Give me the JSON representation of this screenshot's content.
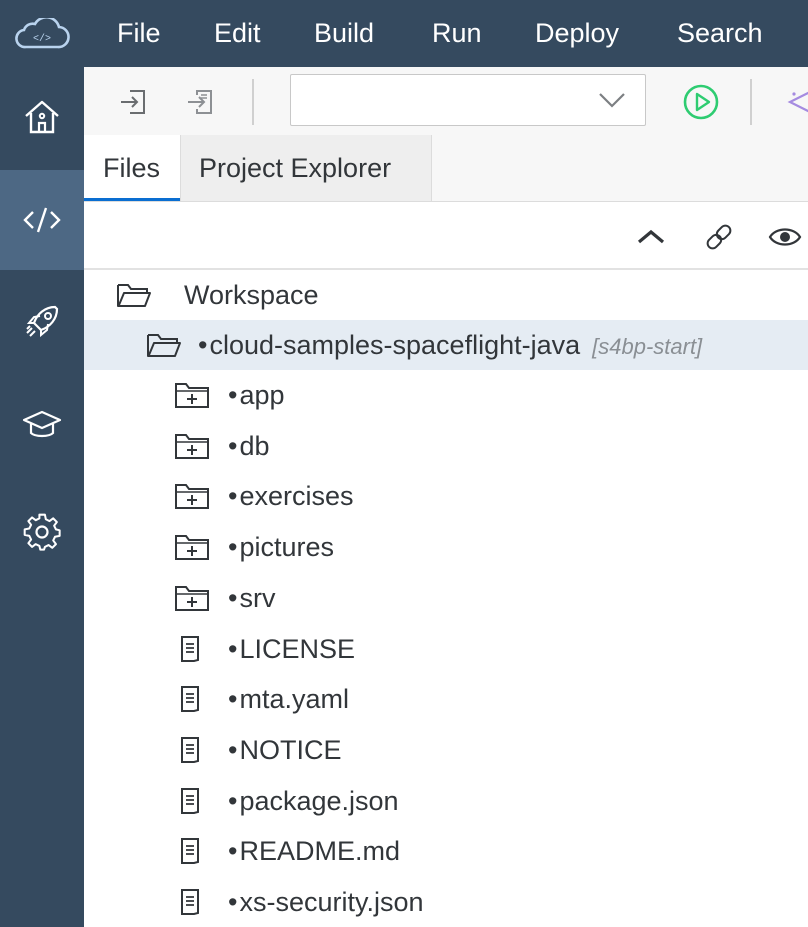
{
  "menu": {
    "items": [
      "File",
      "Edit",
      "Build",
      "Run",
      "Deploy",
      "Search"
    ]
  },
  "sidebar": {
    "items": [
      {
        "name": "home",
        "icon": "home-icon"
      },
      {
        "name": "development",
        "icon": "code-icon",
        "active": true
      },
      {
        "name": "deploy",
        "icon": "rocket-icon"
      },
      {
        "name": "learning",
        "icon": "graduation-cap-icon"
      },
      {
        "name": "preferences",
        "icon": "gear-icon"
      }
    ]
  },
  "toolbar": {
    "run_configuration_value": "",
    "icons": [
      "import-icon",
      "export-icon",
      "run-icon",
      "assistant-icon"
    ]
  },
  "tabs": [
    {
      "label": "Files",
      "active": true
    },
    {
      "label": "Project Explorer",
      "active": false
    }
  ],
  "tree": {
    "workspace_label": "Workspace",
    "project": {
      "label": "cloud-samples-spaceflight-java",
      "branch": "[s4bp-start]"
    },
    "items": [
      {
        "label": "app",
        "type": "folder"
      },
      {
        "label": "db",
        "type": "folder"
      },
      {
        "label": "exercises",
        "type": "folder"
      },
      {
        "label": "pictures",
        "type": "folder"
      },
      {
        "label": "srv",
        "type": "folder"
      },
      {
        "label": "LICENSE",
        "type": "file"
      },
      {
        "label": "mta.yaml",
        "type": "file"
      },
      {
        "label": "NOTICE",
        "type": "file"
      },
      {
        "label": "package.json",
        "type": "file"
      },
      {
        "label": "README.md",
        "type": "file"
      },
      {
        "label": "xs-security.json",
        "type": "file"
      }
    ]
  },
  "colors": {
    "shell": "#354a5f",
    "shell_active": "#4d6884",
    "selection": "#e5ecf3",
    "accent": "#0a6ed1",
    "run_green": "#2ecc71"
  }
}
